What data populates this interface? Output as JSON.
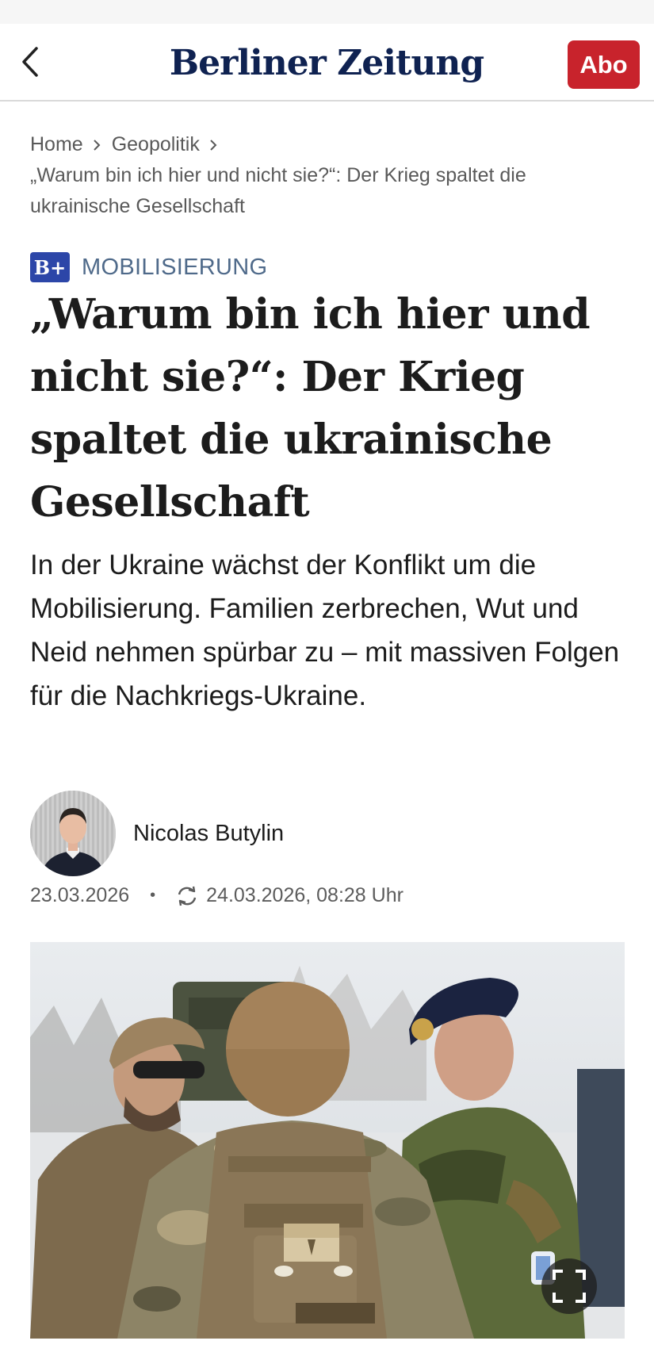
{
  "header": {
    "logo": "Berliner Zeitung",
    "abo_label": "Abo"
  },
  "breadcrumb": {
    "items": [
      "Home",
      "Geopolitik"
    ],
    "current": "„Warum bin ich hier und nicht sie?“: Der Krieg spaltet die ukrainische Gesellschaft"
  },
  "article": {
    "badge": "B+",
    "kicker": "MOBILISIERUNG",
    "headline": "„Warum bin ich hier und nicht sie?“: Der Krieg spaltet die ukrainische Gesellschaft",
    "lead": "In der Ukraine wächst der Konflikt um die Mobilisierung. Familien zerbrechen, Wut und Neid nehmen spürbar zu – mit massiven Folgen für die Nachkriegs-Ukraine.",
    "author": "Nicolas Butylin",
    "published": "23.03.2026",
    "separator": "•",
    "updated": "24.03.2026, 08:28 Uhr"
  },
  "icons": {
    "back": "chevron-left-icon",
    "breadcrumb_separator": "chevron-right-icon",
    "update": "refresh-icon",
    "fullscreen": "fullscreen-icon"
  },
  "colors": {
    "brand_navy": "#0f2251",
    "abo_red": "#c8232c",
    "kicker_blue": "#4f6a8a",
    "badge_blue": "#2c46a8"
  }
}
